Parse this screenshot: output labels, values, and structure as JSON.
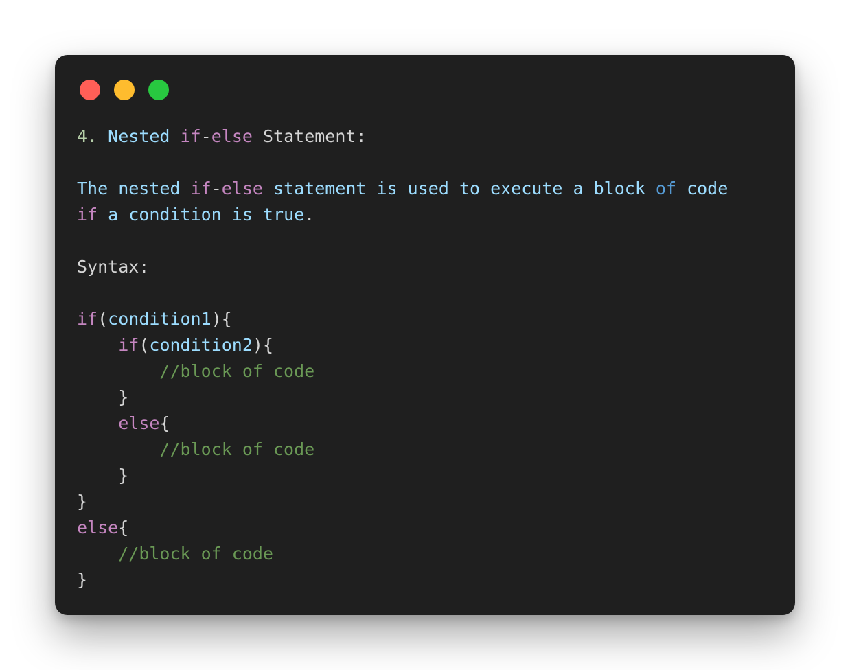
{
  "colors": {
    "background": "#ffffff",
    "window": "#1f1f1f",
    "dot_red": "#ff5f57",
    "dot_yellow": "#febc2e",
    "dot_green": "#28c840",
    "number": "#b5cea8",
    "identifier": "#9cdcfe",
    "keyword": "#c586c0",
    "plain": "#d4d4d4",
    "storage_keyword": "#569cd6",
    "comment": "#6a9955"
  },
  "window_controls": [
    "close-dot",
    "minimize-dot",
    "maximize-dot"
  ],
  "lines": [
    [
      {
        "t": "4.",
        "c": "num"
      },
      {
        "t": " ",
        "c": "plain"
      },
      {
        "t": "Nested",
        "c": "id"
      },
      {
        "t": " ",
        "c": "plain"
      },
      {
        "t": "if",
        "c": "kw"
      },
      {
        "t": "-",
        "c": "plain"
      },
      {
        "t": "else",
        "c": "kw"
      },
      {
        "t": " Statement:",
        "c": "plain"
      }
    ],
    [],
    [
      {
        "t": "The nested ",
        "c": "id"
      },
      {
        "t": "if",
        "c": "kw"
      },
      {
        "t": "-",
        "c": "plain"
      },
      {
        "t": "else",
        "c": "kw"
      },
      {
        "t": " statement is used to execute a block ",
        "c": "id"
      },
      {
        "t": "of",
        "c": "blue"
      },
      {
        "t": " code",
        "c": "id"
      }
    ],
    [
      {
        "t": "if",
        "c": "kw"
      },
      {
        "t": " a condition is true",
        "c": "id"
      },
      {
        "t": ".",
        "c": "plain"
      }
    ],
    [],
    [
      {
        "t": "Syntax:",
        "c": "plain"
      }
    ],
    [],
    [
      {
        "t": "if",
        "c": "kw"
      },
      {
        "t": "(",
        "c": "plain"
      },
      {
        "t": "condition1",
        "c": "id"
      },
      {
        "t": "){",
        "c": "plain"
      }
    ],
    [
      {
        "t": "    ",
        "c": "plain"
      },
      {
        "t": "if",
        "c": "kw"
      },
      {
        "t": "(",
        "c": "plain"
      },
      {
        "t": "condition2",
        "c": "id"
      },
      {
        "t": "){",
        "c": "plain"
      }
    ],
    [
      {
        "t": "        ",
        "c": "plain"
      },
      {
        "t": "//block of code",
        "c": "comment"
      }
    ],
    [
      {
        "t": "    }",
        "c": "plain"
      }
    ],
    [
      {
        "t": "    ",
        "c": "plain"
      },
      {
        "t": "else",
        "c": "kw"
      },
      {
        "t": "{",
        "c": "plain"
      }
    ],
    [
      {
        "t": "        ",
        "c": "plain"
      },
      {
        "t": "//block of code",
        "c": "comment"
      }
    ],
    [
      {
        "t": "    }",
        "c": "plain"
      }
    ],
    [
      {
        "t": "}",
        "c": "plain"
      }
    ],
    [
      {
        "t": "else",
        "c": "kw"
      },
      {
        "t": "{",
        "c": "plain"
      }
    ],
    [
      {
        "t": "    ",
        "c": "plain"
      },
      {
        "t": "//block of code",
        "c": "comment"
      }
    ],
    [
      {
        "t": "}",
        "c": "plain"
      }
    ]
  ]
}
